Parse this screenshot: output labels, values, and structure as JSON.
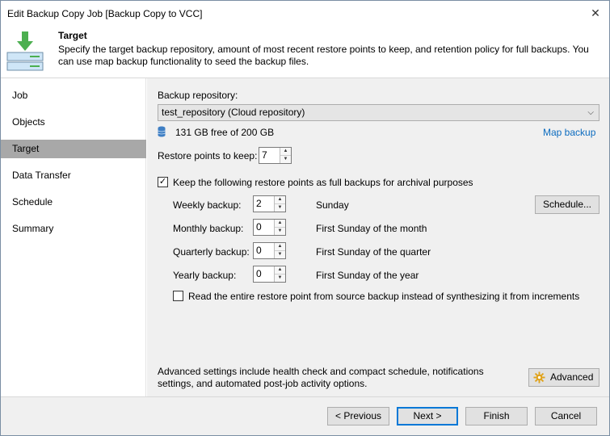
{
  "window": {
    "title": "Edit Backup Copy Job [Backup Copy to VCC]"
  },
  "header": {
    "title": "Target",
    "description": "Specify the target backup repository, amount of most recent restore points to keep, and retention policy for full backups. You can use map backup functionality to seed the backup files."
  },
  "sidebar": {
    "items": [
      {
        "label": "Job"
      },
      {
        "label": "Objects"
      },
      {
        "label": "Target",
        "active": true
      },
      {
        "label": "Data Transfer"
      },
      {
        "label": "Schedule"
      },
      {
        "label": "Summary"
      }
    ]
  },
  "main": {
    "repository_label": "Backup repository:",
    "repository_value": "test_repository (Cloud repository)",
    "space_text": "131 GB free of 200 GB",
    "map_backup_link": "Map backup",
    "restore_points_label": "Restore points to keep:",
    "restore_points_value": "7",
    "keep_full_checked": true,
    "keep_full_label": "Keep the following restore points as full backups for archival purposes",
    "retention": [
      {
        "label": "Weekly backup:",
        "value": "2",
        "desc": "Sunday"
      },
      {
        "label": "Monthly backup:",
        "value": "0",
        "desc": "First Sunday of the month"
      },
      {
        "label": "Quarterly backup:",
        "value": "0",
        "desc": "First Sunday of the quarter"
      },
      {
        "label": "Yearly backup:",
        "value": "0",
        "desc": "First Sunday of the year"
      }
    ],
    "schedule_button": "Schedule...",
    "read_entire_checked": false,
    "read_entire_label": "Read the entire restore point from source backup instead of synthesizing it from increments",
    "advanced_text": "Advanced settings include health check and compact schedule, notifications settings, and automated post-job activity options.",
    "advanced_button": "Advanced"
  },
  "footer": {
    "previous": "< Previous",
    "next": "Next >",
    "finish": "Finish",
    "cancel": "Cancel"
  },
  "colors": {
    "accent": "#0078d7",
    "link": "#0b6bbf",
    "icon_green": "#4caf50",
    "sidebar_active": "#a8a8a8"
  }
}
